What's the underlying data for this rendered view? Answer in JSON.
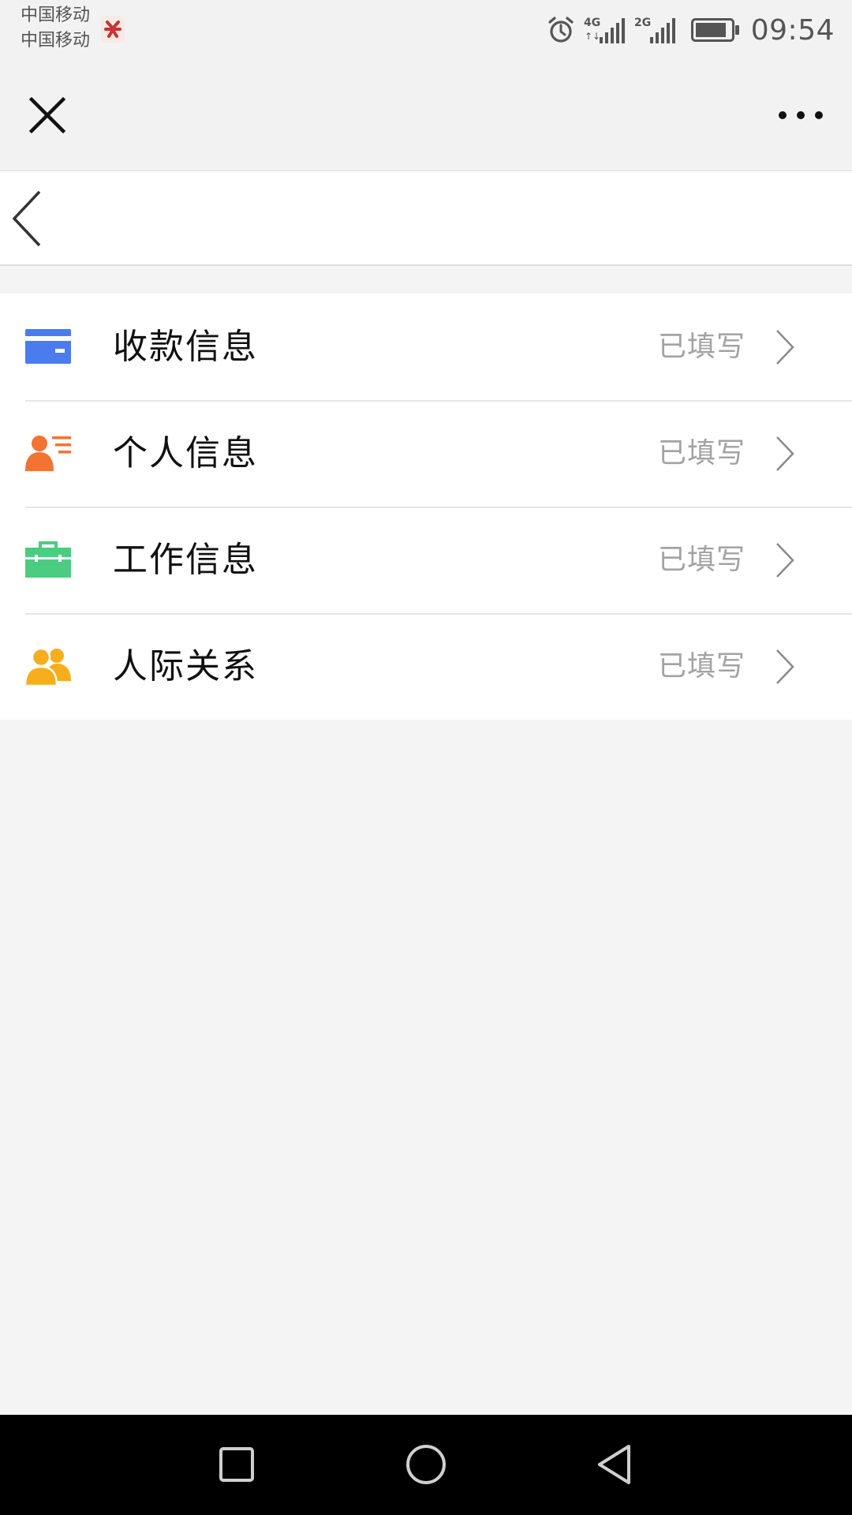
{
  "status_bar": {
    "carrier_1": "中国移动",
    "carrier_2": "中国移动",
    "time": "09:54",
    "network_1": "4G",
    "network_2": "2G",
    "icons": [
      "app-notification-icon",
      "alarm-icon",
      "signal-4g-icon",
      "signal-2g-icon",
      "battery-icon"
    ]
  },
  "title_bar": {
    "close_icon": "close-icon",
    "more_icon": "more-icon"
  },
  "nav_bar": {
    "back_icon": "back-icon"
  },
  "list": {
    "items": [
      {
        "label": "收款信息",
        "status": "已填写",
        "icon": "bank-card-icon",
        "icon_color": "#4a7cf0"
      },
      {
        "label": "个人信息",
        "status": "已填写",
        "icon": "personal-info-icon",
        "icon_color": "#f37332"
      },
      {
        "label": "工作信息",
        "status": "已填写",
        "icon": "briefcase-icon",
        "icon_color": "#4ccc80"
      },
      {
        "label": "人际关系",
        "status": "已填写",
        "icon": "contacts-icon",
        "icon_color": "#f8ad1c"
      }
    ]
  },
  "android_nav": {
    "icons": [
      "recent-apps-icon",
      "home-icon",
      "back-nav-icon"
    ]
  },
  "colors": {
    "background": "#f4f4f4",
    "status_text": "#a3a3a3",
    "label_text": "#111111"
  }
}
